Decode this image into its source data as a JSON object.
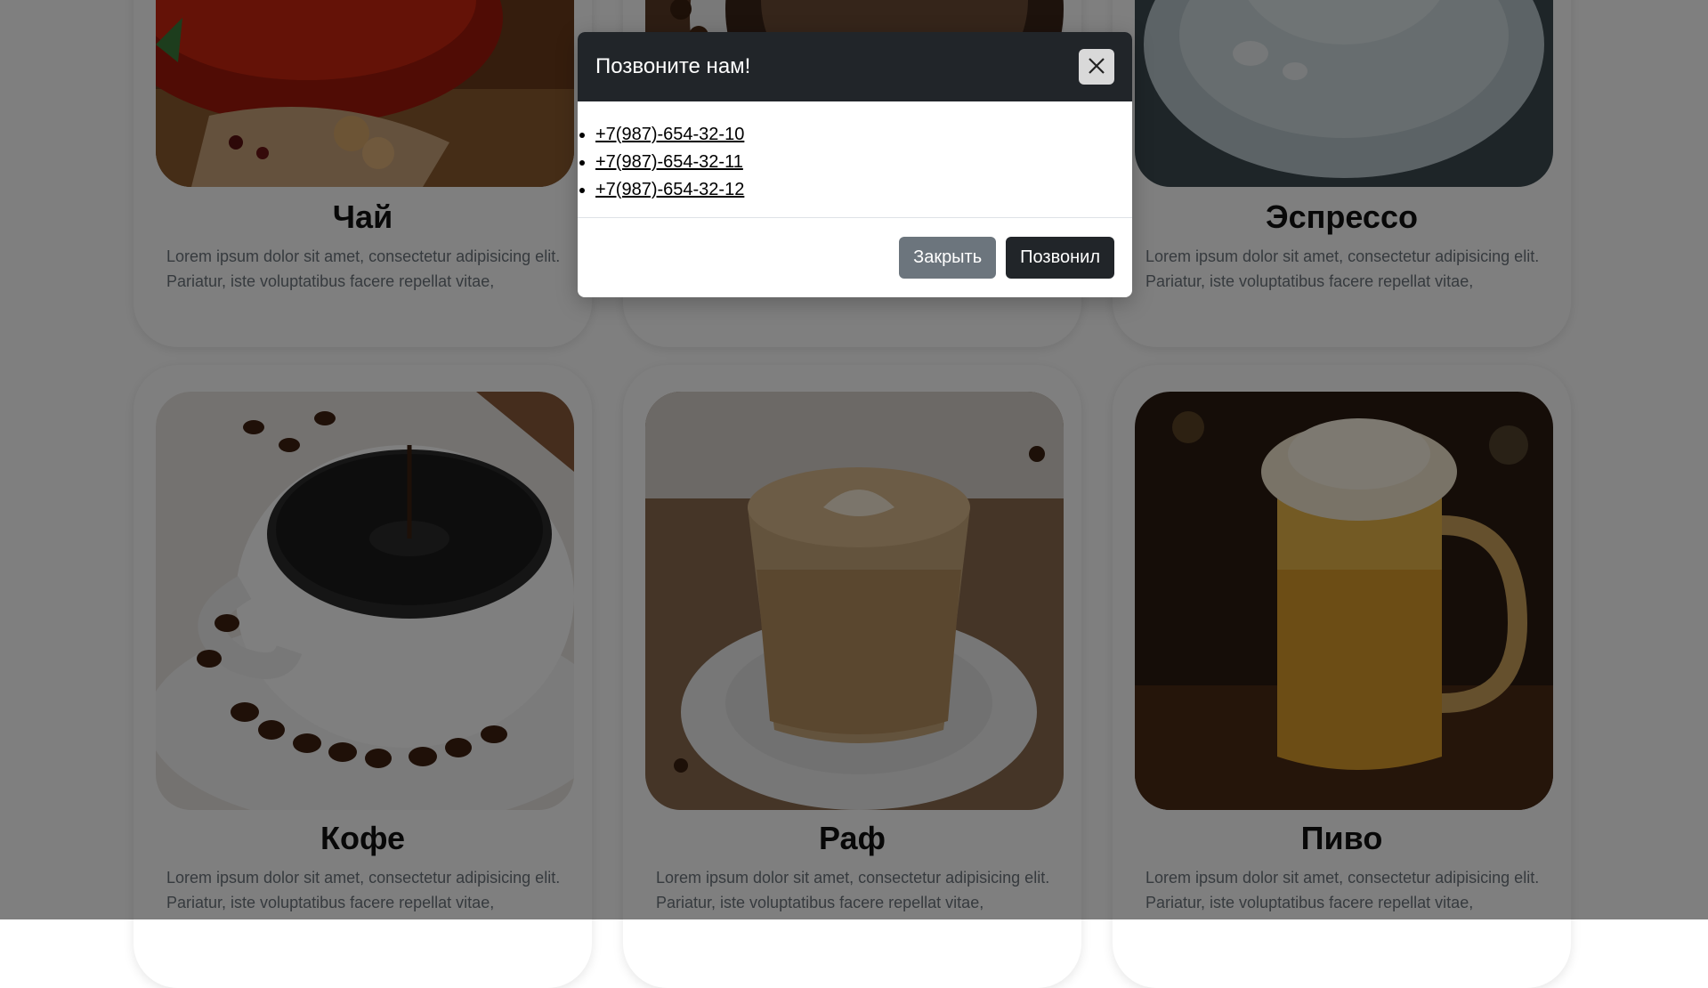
{
  "cards": [
    {
      "title": "Чай",
      "text": "Lorem ipsum dolor sit amet, consectetur adipisicing elit. Pariatur, iste voluptatibus facere repellat vitae,",
      "image": "tea-photo"
    },
    {
      "title": "",
      "text": "",
      "image": "coffee-top-photo"
    },
    {
      "title": "Эспрессо",
      "text": "Lorem ipsum dolor sit amet, consectetur adipisicing elit. Pariatur, iste voluptatibus facere repellat vitae,",
      "image": "espresso-photo"
    },
    {
      "title": "Кофе",
      "text": "Lorem ipsum dolor sit amet, consectetur adipisicing elit. Pariatur, iste voluptatibus facere repellat vitae,",
      "image": "coffee-cup-photo"
    },
    {
      "title": "Раф",
      "text": "Lorem ipsum dolor sit amet, consectetur adipisicing elit. Pariatur, iste voluptatibus facere repellat vitae,",
      "image": "raf-latte-photo"
    },
    {
      "title": "Пиво",
      "text": "Lorem ipsum dolor sit amet, consectetur adipisicing elit. Pariatur, iste voluptatibus facere repellat vitae,",
      "image": "beer-mug-photo"
    }
  ],
  "modal": {
    "title": "Позвоните нам!",
    "close_icon": "close-icon",
    "phones": [
      "+7(987)-654-32-10",
      "+7(987)-654-32-11",
      "+7(987)-654-32-12"
    ],
    "close_button_label": "Закрыть",
    "called_button_label": "Позвонил"
  },
  "colors": {
    "modal_header": "#212529",
    "close_button": "#6c757d",
    "called_button": "#212529",
    "backdrop": "rgba(0,0,0,0.5)"
  }
}
